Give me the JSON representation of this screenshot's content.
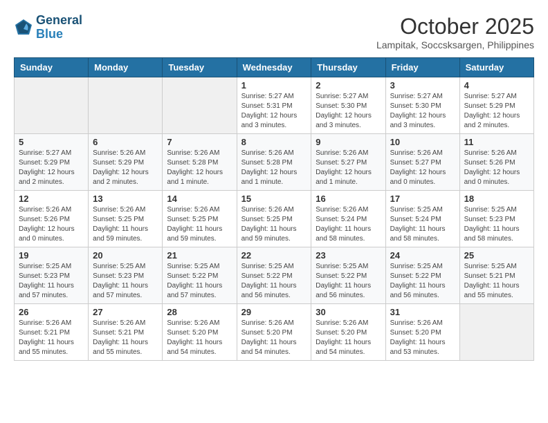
{
  "header": {
    "logo_line1": "General",
    "logo_line2": "Blue",
    "month_year": "October 2025",
    "location": "Lampitak, Soccsksargen, Philippines"
  },
  "weekdays": [
    "Sunday",
    "Monday",
    "Tuesday",
    "Wednesday",
    "Thursday",
    "Friday",
    "Saturday"
  ],
  "weeks": [
    [
      {
        "day": "",
        "info": ""
      },
      {
        "day": "",
        "info": ""
      },
      {
        "day": "",
        "info": ""
      },
      {
        "day": "1",
        "info": "Sunrise: 5:27 AM\nSunset: 5:31 PM\nDaylight: 12 hours\nand 3 minutes."
      },
      {
        "day": "2",
        "info": "Sunrise: 5:27 AM\nSunset: 5:30 PM\nDaylight: 12 hours\nand 3 minutes."
      },
      {
        "day": "3",
        "info": "Sunrise: 5:27 AM\nSunset: 5:30 PM\nDaylight: 12 hours\nand 3 minutes."
      },
      {
        "day": "4",
        "info": "Sunrise: 5:27 AM\nSunset: 5:29 PM\nDaylight: 12 hours\nand 2 minutes."
      }
    ],
    [
      {
        "day": "5",
        "info": "Sunrise: 5:27 AM\nSunset: 5:29 PM\nDaylight: 12 hours\nand 2 minutes."
      },
      {
        "day": "6",
        "info": "Sunrise: 5:26 AM\nSunset: 5:29 PM\nDaylight: 12 hours\nand 2 minutes."
      },
      {
        "day": "7",
        "info": "Sunrise: 5:26 AM\nSunset: 5:28 PM\nDaylight: 12 hours\nand 1 minute."
      },
      {
        "day": "8",
        "info": "Sunrise: 5:26 AM\nSunset: 5:28 PM\nDaylight: 12 hours\nand 1 minute."
      },
      {
        "day": "9",
        "info": "Sunrise: 5:26 AM\nSunset: 5:27 PM\nDaylight: 12 hours\nand 1 minute."
      },
      {
        "day": "10",
        "info": "Sunrise: 5:26 AM\nSunset: 5:27 PM\nDaylight: 12 hours\nand 0 minutes."
      },
      {
        "day": "11",
        "info": "Sunrise: 5:26 AM\nSunset: 5:26 PM\nDaylight: 12 hours\nand 0 minutes."
      }
    ],
    [
      {
        "day": "12",
        "info": "Sunrise: 5:26 AM\nSunset: 5:26 PM\nDaylight: 12 hours\nand 0 minutes."
      },
      {
        "day": "13",
        "info": "Sunrise: 5:26 AM\nSunset: 5:25 PM\nDaylight: 11 hours\nand 59 minutes."
      },
      {
        "day": "14",
        "info": "Sunrise: 5:26 AM\nSunset: 5:25 PM\nDaylight: 11 hours\nand 59 minutes."
      },
      {
        "day": "15",
        "info": "Sunrise: 5:26 AM\nSunset: 5:25 PM\nDaylight: 11 hours\nand 59 minutes."
      },
      {
        "day": "16",
        "info": "Sunrise: 5:26 AM\nSunset: 5:24 PM\nDaylight: 11 hours\nand 58 minutes."
      },
      {
        "day": "17",
        "info": "Sunrise: 5:25 AM\nSunset: 5:24 PM\nDaylight: 11 hours\nand 58 minutes."
      },
      {
        "day": "18",
        "info": "Sunrise: 5:25 AM\nSunset: 5:23 PM\nDaylight: 11 hours\nand 58 minutes."
      }
    ],
    [
      {
        "day": "19",
        "info": "Sunrise: 5:25 AM\nSunset: 5:23 PM\nDaylight: 11 hours\nand 57 minutes."
      },
      {
        "day": "20",
        "info": "Sunrise: 5:25 AM\nSunset: 5:23 PM\nDaylight: 11 hours\nand 57 minutes."
      },
      {
        "day": "21",
        "info": "Sunrise: 5:25 AM\nSunset: 5:22 PM\nDaylight: 11 hours\nand 57 minutes."
      },
      {
        "day": "22",
        "info": "Sunrise: 5:25 AM\nSunset: 5:22 PM\nDaylight: 11 hours\nand 56 minutes."
      },
      {
        "day": "23",
        "info": "Sunrise: 5:25 AM\nSunset: 5:22 PM\nDaylight: 11 hours\nand 56 minutes."
      },
      {
        "day": "24",
        "info": "Sunrise: 5:25 AM\nSunset: 5:22 PM\nDaylight: 11 hours\nand 56 minutes."
      },
      {
        "day": "25",
        "info": "Sunrise: 5:25 AM\nSunset: 5:21 PM\nDaylight: 11 hours\nand 55 minutes."
      }
    ],
    [
      {
        "day": "26",
        "info": "Sunrise: 5:26 AM\nSunset: 5:21 PM\nDaylight: 11 hours\nand 55 minutes."
      },
      {
        "day": "27",
        "info": "Sunrise: 5:26 AM\nSunset: 5:21 PM\nDaylight: 11 hours\nand 55 minutes."
      },
      {
        "day": "28",
        "info": "Sunrise: 5:26 AM\nSunset: 5:20 PM\nDaylight: 11 hours\nand 54 minutes."
      },
      {
        "day": "29",
        "info": "Sunrise: 5:26 AM\nSunset: 5:20 PM\nDaylight: 11 hours\nand 54 minutes."
      },
      {
        "day": "30",
        "info": "Sunrise: 5:26 AM\nSunset: 5:20 PM\nDaylight: 11 hours\nand 54 minutes."
      },
      {
        "day": "31",
        "info": "Sunrise: 5:26 AM\nSunset: 5:20 PM\nDaylight: 11 hours\nand 53 minutes."
      },
      {
        "day": "",
        "info": ""
      }
    ]
  ]
}
